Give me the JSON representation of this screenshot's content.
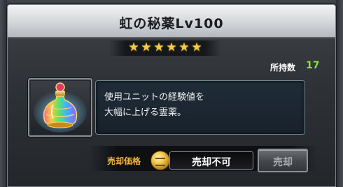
{
  "dialog": {
    "title": "虹の秘薬Lv100",
    "star_count": 6,
    "star_color": "#f3cd4a",
    "owned_label": "所持数",
    "owned_count": "17",
    "owned_count_color": "#8fe03a"
  },
  "item": {
    "icon": "rainbow-elixir-icon",
    "description_lines": [
      "使用ユニットの経験値を",
      "大幅に上げる霊薬。"
    ]
  },
  "sell": {
    "label": "売却価格",
    "label_color": "#f3b63c",
    "coin_icon": "gold-coin-icon",
    "price_text": "売却不可",
    "button_label": "売却",
    "button_enabled": false
  }
}
